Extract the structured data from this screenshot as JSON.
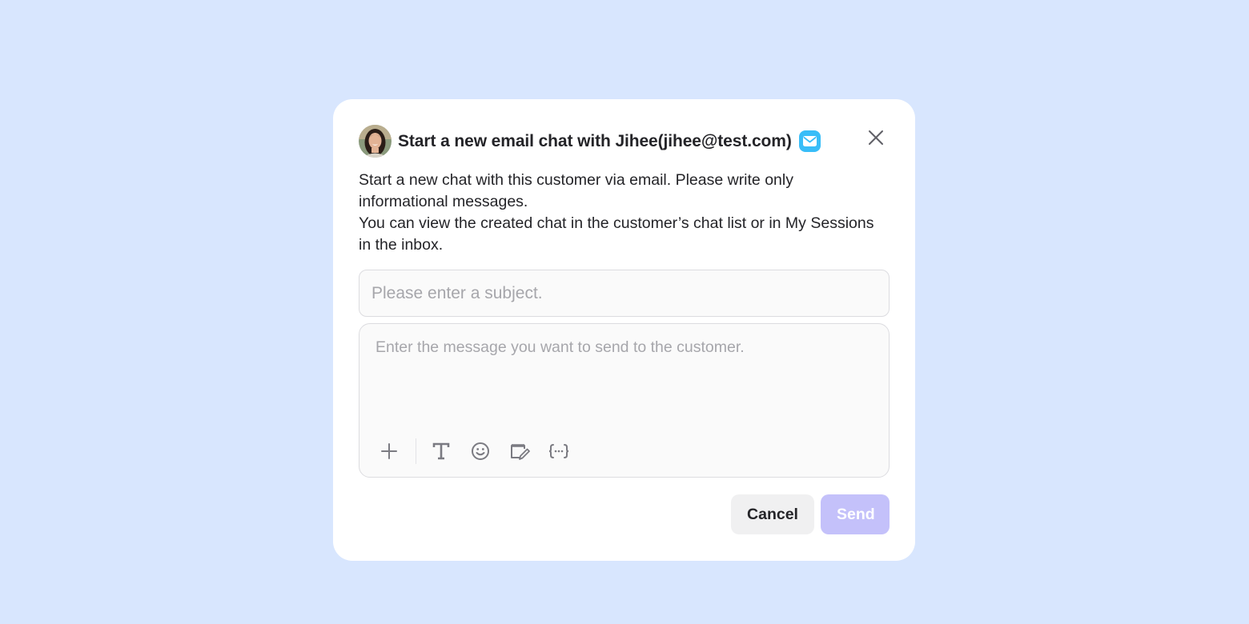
{
  "modal": {
    "title": "Start a new email chat with Jihee(jihee@test.com)",
    "avatar": "customer-avatar",
    "channel_icon": "mail-icon",
    "close_icon": "close-icon",
    "description": [
      "Start a new chat with this customer via email. Please write only informational messages.",
      "You can view the created chat in the customer’s chat list or in My Sessions in the inbox."
    ],
    "subject": {
      "value": "",
      "placeholder": "Please enter a subject."
    },
    "message": {
      "value": "",
      "placeholder": "Enter the message you want to send to the customer."
    },
    "toolbar": {
      "items": [
        "add-icon",
        "text-format-icon",
        "emoji-icon",
        "template-icon",
        "variable-icon"
      ]
    },
    "buttons": {
      "cancel": "Cancel",
      "send": "Send"
    },
    "colors": {
      "background": "#d8e6fe",
      "accent_disabled": "#c4c1fa",
      "channel": "#38bdf8"
    }
  }
}
